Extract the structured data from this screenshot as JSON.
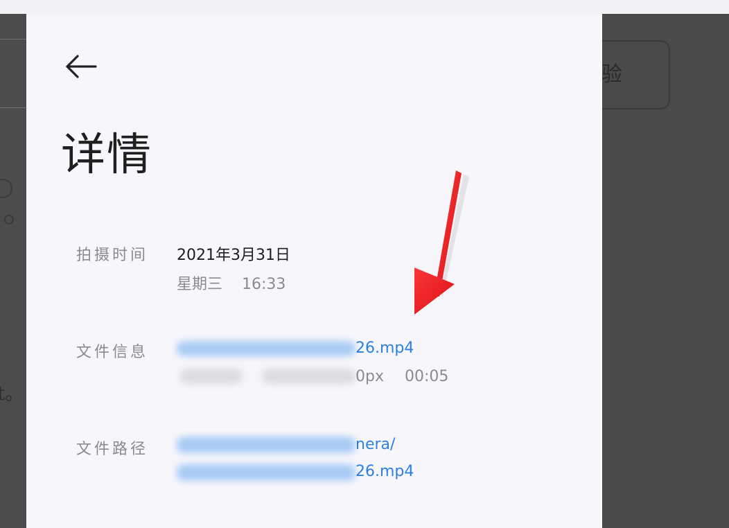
{
  "header": {
    "back_icon": "arrow-left-icon",
    "title": "详情"
  },
  "details": {
    "capture_time": {
      "label": "拍摄时间",
      "date": "2021年3月31日",
      "weekday": "星期三",
      "time": "16:33"
    },
    "file_info": {
      "label": "文件信息",
      "filename_visible": "26.mp4",
      "resolution_visible": "0px",
      "duration": "00:05"
    },
    "file_path": {
      "label": "文件路径",
      "line1_visible": "nera/",
      "line2_visible": "26.mp4"
    }
  },
  "background": {
    "right_button_fragment": "验",
    "left_fragment": "t。"
  },
  "annotation": {
    "icon": "red-arrow-icon",
    "color": "#e8151b"
  },
  "colors": {
    "link": "#2d7fe0",
    "label": "#8b8b8b",
    "text": "#1d1d1d",
    "panel_bg": "#f7f7fb"
  }
}
